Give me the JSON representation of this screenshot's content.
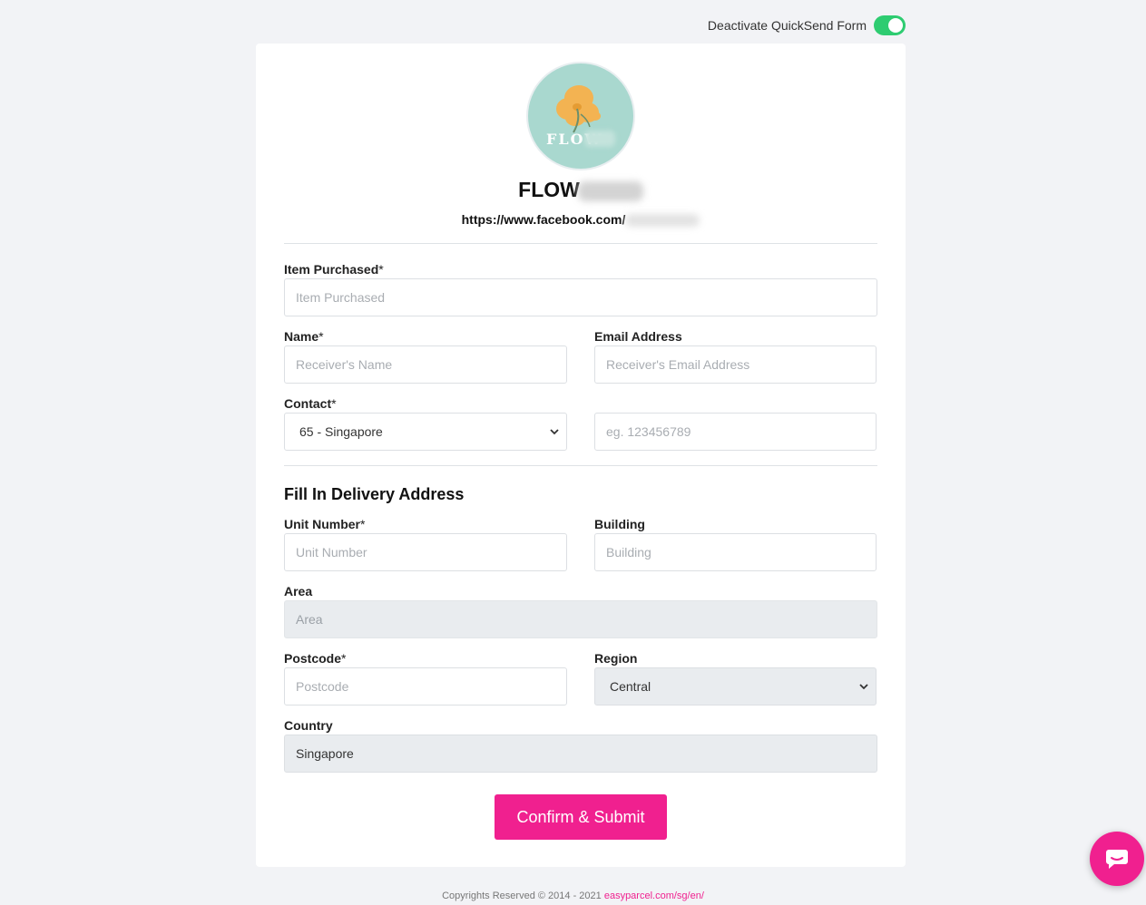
{
  "topbar": {
    "toggle_label": "Deactivate QuickSend Form",
    "toggle_on": true,
    "toggle_color": "#2ecc71"
  },
  "shop": {
    "logo_text": "FLOW",
    "name_visible": "FLOW",
    "link_visible": "https://www.facebook.com/"
  },
  "form": {
    "item": {
      "label": "Item Purchased",
      "required": "*",
      "placeholder": "Item Purchased"
    },
    "name": {
      "label": "Name",
      "required": "*",
      "placeholder": "Receiver's Name"
    },
    "email": {
      "label": "Email Address",
      "placeholder": "Receiver's Email Address"
    },
    "contact": {
      "label": "Contact",
      "required": "*",
      "country_code": "65 - Singapore",
      "placeholder": "eg. 123456789"
    },
    "section_title": "Fill In Delivery Address",
    "unit": {
      "label": "Unit Number",
      "required": "*",
      "placeholder": "Unit Number"
    },
    "building": {
      "label": "Building",
      "placeholder": "Building"
    },
    "area": {
      "label": "Area",
      "placeholder": "Area"
    },
    "postcode": {
      "label": "Postcode",
      "required": "*",
      "placeholder": "Postcode"
    },
    "region": {
      "label": "Region",
      "value": "Central"
    },
    "country": {
      "label": "Country",
      "value": "Singapore"
    },
    "submit_label": "Confirm & Submit"
  },
  "footer": {
    "text": "Copyrights Reserved © 2014 - 2021",
    "link": "easyparcel.com/sg/en/"
  },
  "colors": {
    "brand": "#f0208f",
    "toggle": "#2ecc71",
    "page_bg": "#f2f3f6"
  },
  "icons": {
    "chat": "chat-bubble-icon",
    "select_arrow": "chevron-down-icon"
  }
}
